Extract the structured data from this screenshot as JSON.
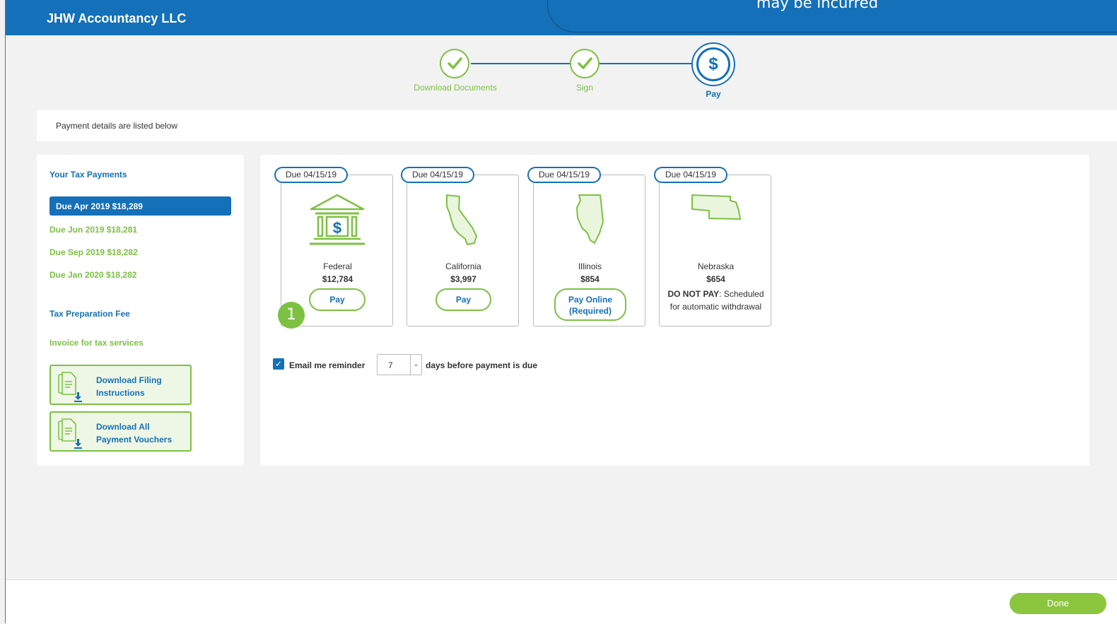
{
  "header": {
    "title": "JHW Accountancy LLC",
    "callout_text": "may be incurred"
  },
  "steps": [
    {
      "label": "Download Documents",
      "state": "done"
    },
    {
      "label": "Sign",
      "state": "done"
    },
    {
      "label": "Pay",
      "state": "active",
      "icon_text": "$"
    }
  ],
  "banner": {
    "text": "Payment details are listed below"
  },
  "sidebar": {
    "heading": "Your Tax Payments",
    "payments": [
      {
        "label": "Due Apr 2019 $18,289",
        "active": true
      },
      {
        "label": "Due Jun 2019 $18,281"
      },
      {
        "label": "Due Sep 2019 $18,282"
      },
      {
        "label": "Due Jan 2020 $18,282"
      }
    ],
    "fee_heading": "Tax Preparation Fee",
    "invoice_link": "Invoice for tax services",
    "download_filing": [
      "Download Filing",
      "Instructions"
    ],
    "download_vouchers": [
      "Download All",
      "Payment Vouchers"
    ]
  },
  "cards": [
    {
      "due": "Due 04/15/19",
      "name": "Federal",
      "amount": "$12,784",
      "button": "Pay",
      "icon": "bank-icon"
    },
    {
      "due": "Due 04/15/19",
      "name": "California",
      "amount": "$3,997",
      "button": "Pay",
      "icon": "california-map-icon"
    },
    {
      "due": "Due 04/15/19",
      "name": "Illinois",
      "amount": "$854",
      "button_line1": "Pay Online",
      "button_line2": "(Required)",
      "icon": "illinois-map-icon"
    },
    {
      "due": "Due 04/15/19",
      "name": "Nebraska",
      "amount": "$654",
      "note_bold": "DO NOT PAY",
      "note_rest": ": Scheduled",
      "note_line2": "for automatic withdrawal",
      "icon": "nebraska-map-icon"
    }
  ],
  "marker": "1",
  "reminder": {
    "checked": true,
    "label_before": "Email me reminder",
    "days": "7",
    "label_after": "days before payment is due"
  },
  "footer": {
    "done_label": "Done"
  },
  "colors": {
    "brand_blue": "#1470b8",
    "accent_green": "#7cc142"
  }
}
